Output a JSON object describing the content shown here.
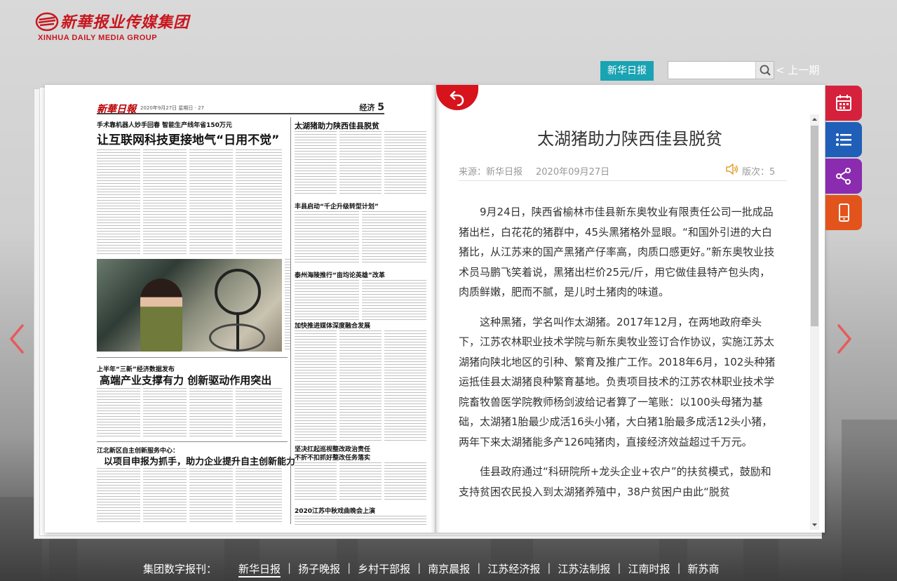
{
  "header": {
    "logo_cn": "新華报业传媒集团",
    "logo_en": "XINHUA DAILY MEDIA GROUP",
    "paper_button": "新华日报",
    "search_placeholder": "",
    "prev_issue": "< 上一期"
  },
  "newspaper_page": {
    "masthead": "新華日報",
    "date_line": "2020年9月27日  星期日",
    "page_number": "27",
    "section": "经济",
    "section_page": "5",
    "headlines": [
      {
        "kicker": "手术靠机器人妙手回春  智能生产线年省150万元",
        "title": "让互联网科技更接地气“日用不觉”"
      },
      {
        "title": "太湖猪助力陕西佳县脱贫"
      },
      {
        "title": "丰县启动“千企升级转型计划”"
      },
      {
        "title": "泰州海陵推行“亩均论英雄”改革"
      },
      {
        "title": "加快推进媒体深度融合发展"
      },
      {
        "kicker": "上半年“三新”经济数据发布",
        "title": "高端产业支撑有力  创新驱动作用突出"
      },
      {
        "kicker": "江北新区自主创新服务中心：",
        "title": "以项目申报为抓手，助力企业提升自主创新能力"
      },
      {
        "title": "坚决扛起巡视整改政治责任"
      },
      {
        "title": "不折不扣抓好整改任务落实"
      },
      {
        "title": "2020江苏中秋戏曲晚会上演"
      }
    ]
  },
  "article": {
    "title": "太湖猪助力陕西佳县脱贫",
    "source": "来源：新华日报",
    "date": "2020年09月27日",
    "edition": "版次：5",
    "paragraphs": [
      "9月24日，陕西省榆林市佳县新东奥牧业有限责任公司一批成品猪出栏，白花花的猪群中，45头黑猪格外显眼。“和国外引进的大白猪比，从江苏来的国产黑猪产仔率高，肉质口感更好。”新东奥牧业技术员马鹏飞笑着说，黑猪出栏价25元/斤，用它做佳县特产包头肉，肉质鲜嫩，肥而不腻，是儿时土猪肉的味道。",
      "这种黑猪，学名叫作太湖猪。2017年12月，在两地政府牵头下，江苏农林职业技术学院与新东奥牧业签订合作协议，实施江苏太湖猪向陕北地区的引种、繁育及推广工作。2018年6月，102头种猪运抵佳县太湖猪良种繁育基地。负责项目技术的江苏农林职业技术学院畜牧兽医学院教师杨剑波给记者算了一笔账：以100头母猪为基础，太湖猪1胎最少成活16头小猪，大白猪1胎最多成活12头小猪，两年下来太湖猪能多产126吨猪肉，直接经济效益超过千万元。",
      "佳县政府通过“科研院所+龙头企业+农户”的扶贫模式，鼓励和支持贫困农民投入到太湖猪养殖中，38户贫困户由此“脱贫"
    ]
  },
  "tools": [
    {
      "name": "calendar",
      "color": "#d6213d"
    },
    {
      "name": "list",
      "color": "#1f5fb8"
    },
    {
      "name": "share",
      "color": "#8a2bb0"
    },
    {
      "name": "mobile",
      "color": "#e2541c"
    }
  ],
  "footer": {
    "label": "集团数字报刊：",
    "links": [
      "新华日报",
      "扬子晚报",
      "乡村干部报",
      "南京晨报",
      "江苏经济报",
      "江苏法制报",
      "江南时报",
      "新苏商"
    ],
    "active": "新华日报"
  }
}
